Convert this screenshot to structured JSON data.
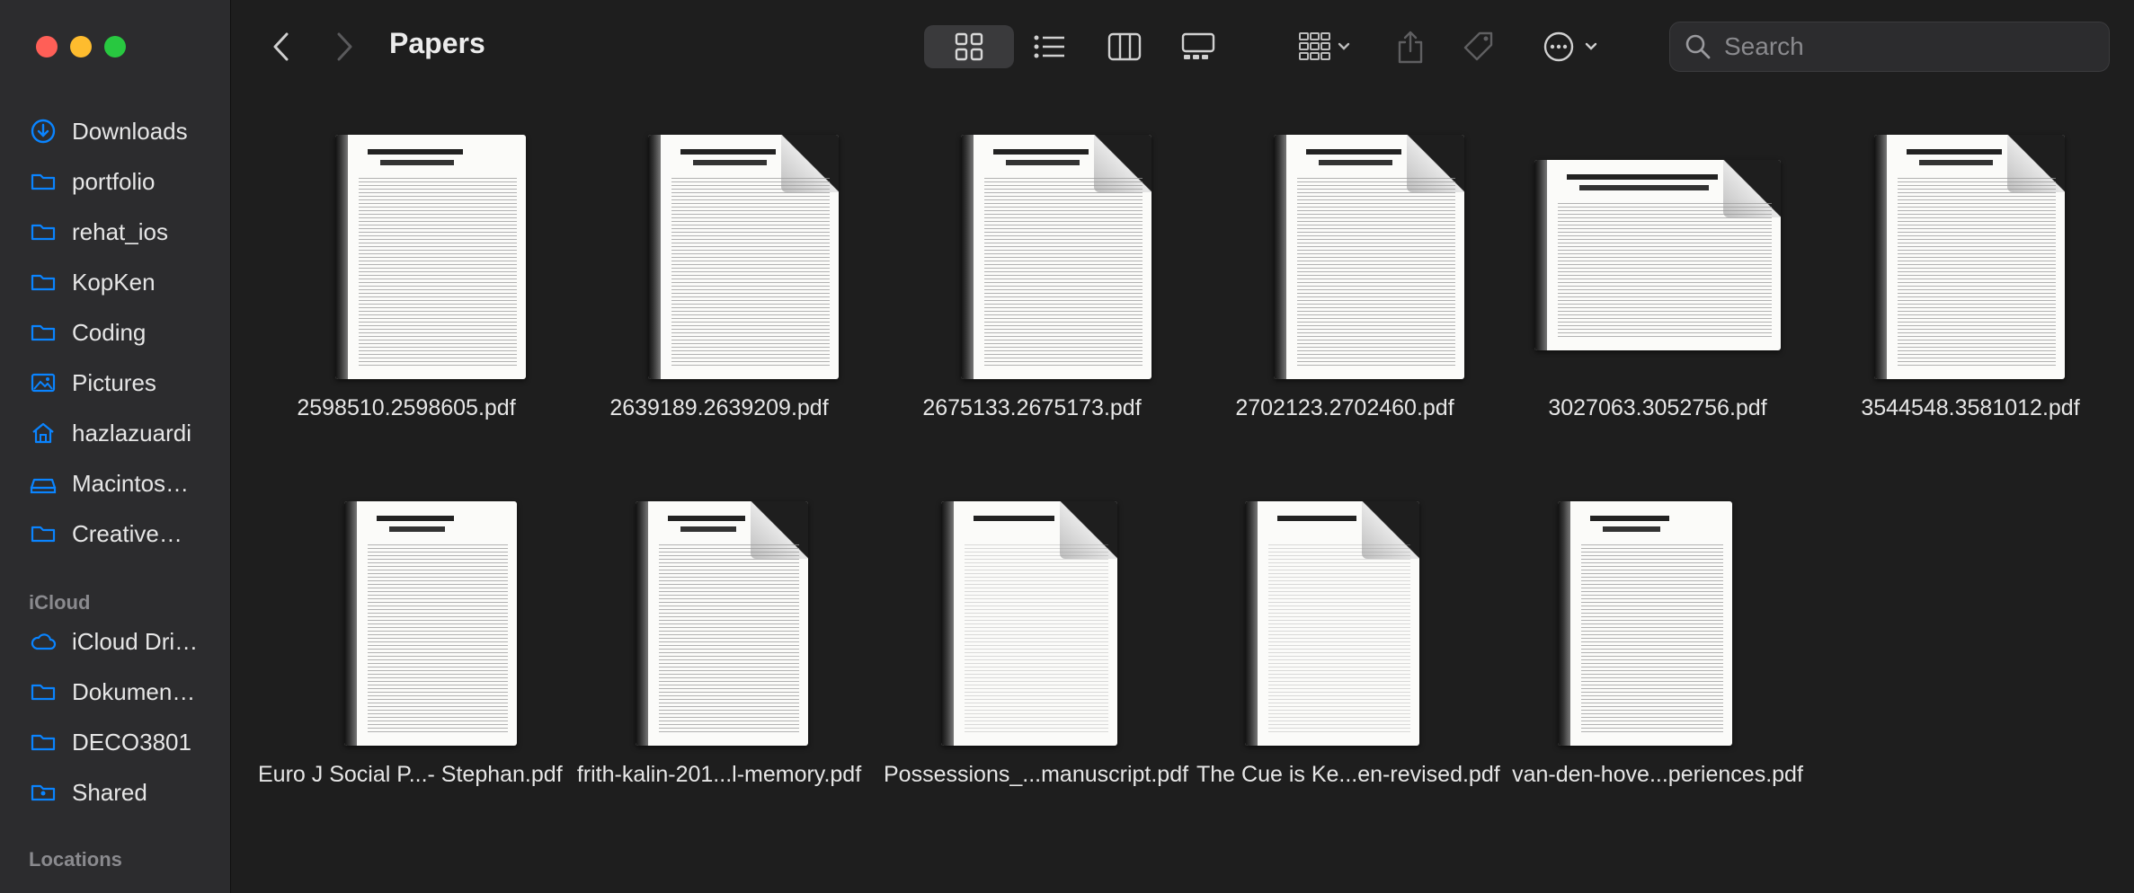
{
  "window": {
    "title": "Papers"
  },
  "sidebar": {
    "favorites": [
      {
        "label": "Downloads",
        "icon": "download-icon"
      },
      {
        "label": "portfolio",
        "icon": "folder-icon"
      },
      {
        "label": "rehat_ios",
        "icon": "folder-icon"
      },
      {
        "label": "KopKen",
        "icon": "folder-icon"
      },
      {
        "label": "Coding",
        "icon": "folder-icon"
      },
      {
        "label": "Pictures",
        "icon": "photo-icon"
      },
      {
        "label": "hazlazuardi",
        "icon": "home-icon"
      },
      {
        "label": "Macintos…",
        "icon": "drive-icon"
      },
      {
        "label": "Creative…",
        "icon": "folder-icon"
      }
    ],
    "icloud_heading": "iCloud",
    "icloud": [
      {
        "label": "iCloud Dri…",
        "icon": "cloud-icon"
      },
      {
        "label": "Dokumen…",
        "icon": "folder-icon"
      },
      {
        "label": "DECO3801",
        "icon": "folder-icon"
      },
      {
        "label": "Shared",
        "icon": "shared-folder-icon"
      }
    ],
    "locations_heading": "Locations"
  },
  "toolbar": {
    "search_placeholder": "Search",
    "active_view": "icon-view",
    "accent": "#0a84ff"
  },
  "files": [
    {
      "name": "2598510.2598605.pdf"
    },
    {
      "name": "2639189.2639209.pdf"
    },
    {
      "name": "2675133.2675173.pdf"
    },
    {
      "name": "2702123.2702460.pdf"
    },
    {
      "name": "3027063.3052756.pdf"
    },
    {
      "name": "3544548.3581012.pdf"
    },
    {
      "name": "Euro J Social P...- Stephan.pdf"
    },
    {
      "name": "frith-kalin-201...l-memory.pdf"
    },
    {
      "name": "Possessions_...manuscript.pdf"
    },
    {
      "name": "The Cue is Ke...en-revised.pdf"
    },
    {
      "name": "van-den-hove...periences.pdf"
    }
  ]
}
